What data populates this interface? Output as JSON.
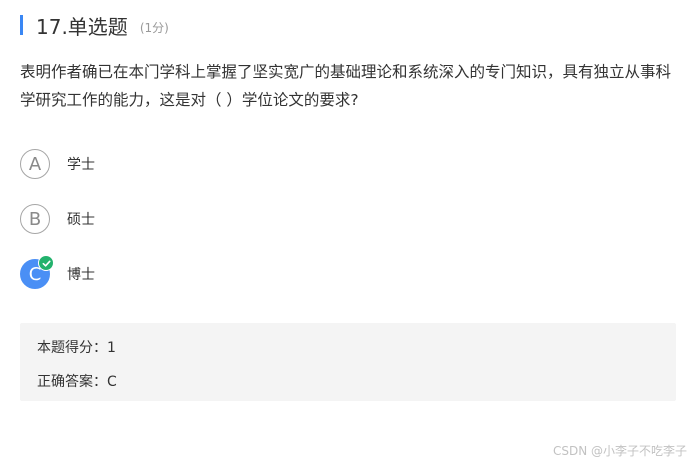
{
  "question": {
    "title": "17.单选题",
    "score": "(1分)",
    "stem": "表明作者确已在本门学科上掌握了坚实宽广的基础理论和系统深入的专门知识，具有独立从事科学研究工作的能力，这是对（   ）学位论文的要求?"
  },
  "options": [
    {
      "letter": "A",
      "text": "学士"
    },
    {
      "letter": "B",
      "text": "硕士"
    },
    {
      "letter": "C",
      "text": "博士"
    }
  ],
  "result": {
    "score_label": "本题得分：",
    "score_value": "1",
    "answer_label": "正确答案：",
    "answer_value": "C"
  },
  "watermark": "CSDN @小李子不吃李子",
  "colors": {
    "accent": "#3a87f4",
    "selected": "#4a8ff5",
    "correct": "#23b26d"
  }
}
